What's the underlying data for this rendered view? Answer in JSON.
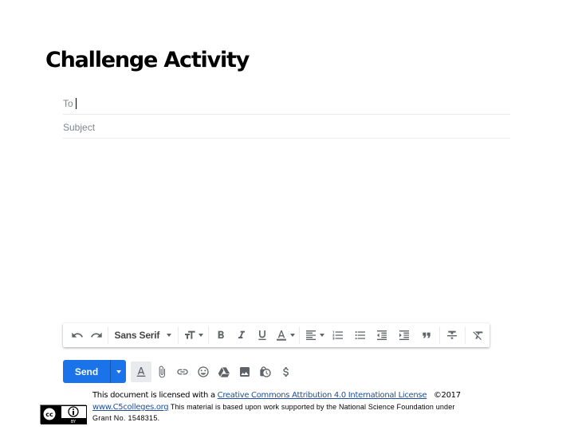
{
  "slide": {
    "title": "Challenge Activity"
  },
  "compose": {
    "to_label": "To",
    "subject_label": "Subject"
  },
  "format_toolbar": {
    "undo": "undo-icon",
    "redo": "redo-icon",
    "font_family": "Sans Serif",
    "buttons": [
      "text-size",
      "bold",
      "italic",
      "underline",
      "text-color",
      "align",
      "numbered-list",
      "bulleted-list",
      "indent-less",
      "indent-more",
      "quote",
      "strikethrough",
      "remove-formatting"
    ]
  },
  "action_bar": {
    "send_label": "Send",
    "send_color": "#1a73e8",
    "icons": [
      "formatting-options",
      "attach-files",
      "insert-link",
      "insert-emoji",
      "insert-drive-file",
      "insert-photo",
      "confidential-mode",
      "send-money"
    ]
  },
  "footer": {
    "line1_prefix": "This document is licensed with a ",
    "license_link": "Creative Commons Attribution 4.0 International License",
    "copyright": "©2017",
    "site_link": "www.C5colleges.org",
    "line2_suffix": " This material is based upon work supported by the National Science Foundation under",
    "line3": "Grant No. 1548315.",
    "badge_text": "BY"
  }
}
